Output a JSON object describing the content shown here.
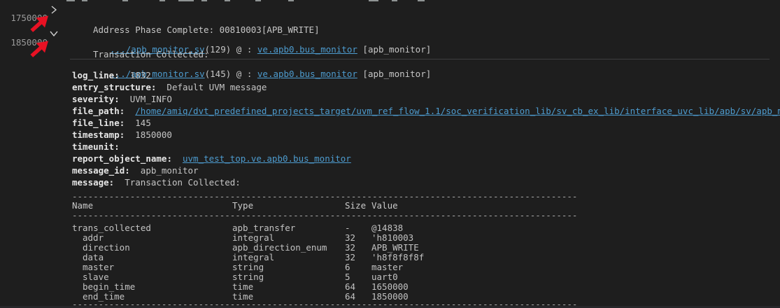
{
  "log": {
    "entries": [
      {
        "timestamp": "1750000",
        "file_link": ".../apb_monitor.sv",
        "line_ref": "(129) @ : ",
        "object_link": "ve.apb0.bus_monitor",
        "tag": " [apb_monitor]",
        "message": "Address Phase Complete: 00810003[APB_WRITE]"
      },
      {
        "timestamp": "1850000",
        "file_link": ".../apb_monitor.sv",
        "line_ref": "(145) @ : ",
        "object_link": "ve.apb0.bus_monitor",
        "tag": " [apb_monitor]",
        "message": "Transaction Collected:"
      }
    ]
  },
  "details": {
    "fields": [
      {
        "label": "log_line:",
        "value": "1832"
      },
      {
        "label": "entry_structure:",
        "value": "Default UVM message"
      },
      {
        "label": "severity:",
        "value": "UVM_INFO"
      },
      {
        "label": "file_path:",
        "value": "/home/amiq/dvt_predefined_projects_target/uvm_ref_flow_1.1/soc_verification_lib/sv_cb_ex_lib/interface_uvc_lib/apb/sv/apb_monitor.sv"
      },
      {
        "label": "file_line:",
        "value": "145"
      },
      {
        "label": "timestamp:",
        "value": "1850000"
      },
      {
        "label": "timeunit:",
        "value": ""
      },
      {
        "label": "report_object_name:",
        "value": "uvm_test_top.ve.apb0.bus_monitor"
      },
      {
        "label": "message_id:",
        "value": "apb_monitor"
      },
      {
        "label": "message:",
        "value": "Transaction Collected:"
      }
    ]
  },
  "table": {
    "separator": "------------------------------------------------------------------------------------------------",
    "headers": {
      "name": "Name",
      "type": "Type",
      "size": "Size",
      "value": "Value"
    },
    "rows": [
      {
        "name": "trans_collected",
        "type": "apb_transfer",
        "size": "-",
        "value": "@14838"
      },
      {
        "name": "addr",
        "type": "integral",
        "size": "32",
        "value": "'h810003"
      },
      {
        "name": "direction",
        "type": "apb_direction_enum",
        "size": "32",
        "value": "APB_WRITE"
      },
      {
        "name": "data",
        "type": "integral",
        "size": "32",
        "value": "'h8f8f8f8f"
      },
      {
        "name": "master",
        "type": "string",
        "size": "6",
        "value": "master"
      },
      {
        "name": "slave",
        "type": "string",
        "size": "5",
        "value": "uart0"
      },
      {
        "name": "begin_time",
        "type": "time",
        "size": "64",
        "value": "1650000"
      },
      {
        "name": "end_time",
        "type": "time",
        "size": "64",
        "value": "1850000"
      }
    ]
  },
  "colors": {
    "link": "#4d9bce",
    "annotation_arrow": "#e81123",
    "background": "#1e1e1e"
  }
}
